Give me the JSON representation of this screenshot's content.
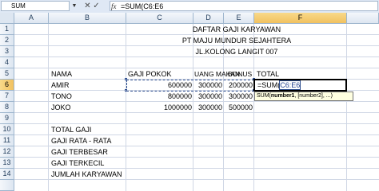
{
  "formula_bar": {
    "name_box": "SUM",
    "cancel_glyph": "✕",
    "enter_glyph": "✓",
    "fx_label": "fx",
    "formula_prefix": "=SUM(",
    "formula_ref": "C6:E6"
  },
  "columns": [
    "A",
    "B",
    "C",
    "D",
    "E",
    "F"
  ],
  "rows": [
    "1",
    "2",
    "3",
    "4",
    "5",
    "6",
    "7",
    "8",
    "9",
    "10",
    "11",
    "12",
    "13",
    "14"
  ],
  "title": {
    "line1": "DAFTAR GAJI KARYAWAN",
    "line2": "PT MAJU MUNDUR SEJAHTERA",
    "line3": "JL.KOLONG LANGIT 007"
  },
  "table": {
    "headers": {
      "nama": "NAMA",
      "gaji_pokok": "GAJI POKOK",
      "uang_makan": "UANG MAKAN",
      "bonus": "BONUS",
      "total": "TOTAL"
    },
    "rows": [
      {
        "nama": "AMIR",
        "gaji_pokok": "600000",
        "uang_makan": "300000",
        "bonus": "200000"
      },
      {
        "nama": "TONO",
        "gaji_pokok": "800000",
        "uang_makan": "300000",
        "bonus": "300000"
      },
      {
        "nama": "JOKO",
        "gaji_pokok": "1000000",
        "uang_makan": "300000",
        "bonus": "500000"
      }
    ]
  },
  "summary": [
    "TOTAL GAJI",
    "GAJI RATA - RATA",
    "GAJI TERBESAR",
    "GAJI TERKECIL",
    "JUMLAH KARYAWAN"
  ],
  "edit": {
    "prefix": "=SUM(",
    "ref": "C6:E6",
    "tip_fn": "SUM(",
    "tip_arg1": "number1",
    "tip_rest": ", [number2], ...)"
  }
}
